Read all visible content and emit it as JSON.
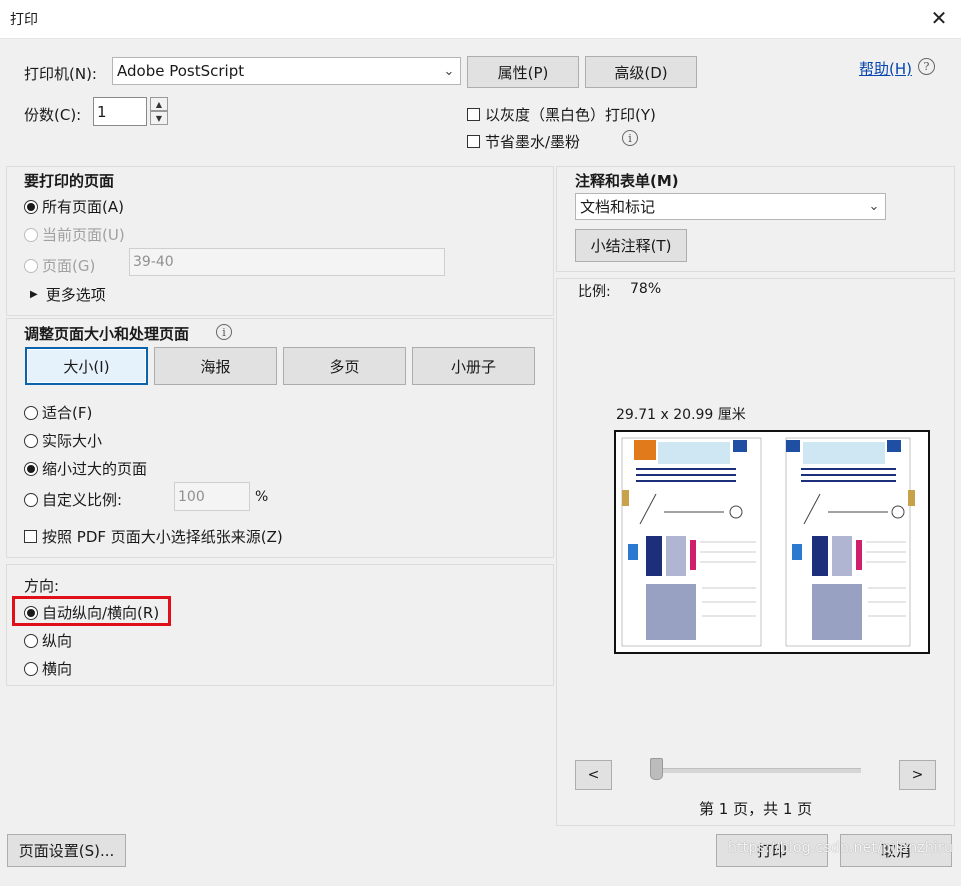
{
  "window": {
    "title": "打印",
    "close_glyph": "✕"
  },
  "printer": {
    "label": "打印机(N):",
    "selected": "Adobe PostScript",
    "properties_btn": "属性(P)",
    "advanced_btn": "高级(D)",
    "help_link": "帮助(H)",
    "copies_label": "份数(C):",
    "copies_value": "1",
    "grayscale_label": "以灰度（黑白色）打印(Y)",
    "save_ink_label": "节省墨水/墨粉"
  },
  "pages_to_print": {
    "heading": "要打印的页面",
    "all_pages": "所有页面(A)",
    "current_page": "当前页面(U)",
    "pages": "页面(G)",
    "pages_value": "39-40",
    "more_options": "更多选项"
  },
  "comments_forms": {
    "heading": "注释和表单(M)",
    "selected": "文档和标记",
    "summarize_btn": "小结注释(T)"
  },
  "sizing": {
    "heading": "调整页面大小和处理页面",
    "tabs": [
      "大小(I)",
      "海报",
      "多页",
      "小册子"
    ],
    "fit": "适合(F)",
    "actual_size": "实际大小",
    "shrink_oversized": "缩小过大的页面",
    "custom_scale": "自定义比例:",
    "custom_scale_value": "100",
    "percent": "%",
    "paper_source": "按照 PDF 页面大小选择纸张来源(Z)"
  },
  "orientation": {
    "heading": "方向:",
    "auto": "自动纵向/横向(R)",
    "portrait": "纵向",
    "landscape": "横向"
  },
  "preview": {
    "scale_label": "比例:",
    "scale_value": "78%",
    "dimensions": "29.71 x 20.99 厘米",
    "prev": "<",
    "next": ">",
    "page_info": "第 1 页，共 1 页"
  },
  "footer": {
    "page_setup_btn": "页面设置(S)...",
    "print_btn": "打印",
    "cancel_btn": "取消",
    "watermark": "https://blog.csdn.net/pjlanzhiru"
  },
  "colors": {
    "highlight": "#e0101a",
    "link": "#0645ad",
    "active_tab": "#0a64ad"
  }
}
